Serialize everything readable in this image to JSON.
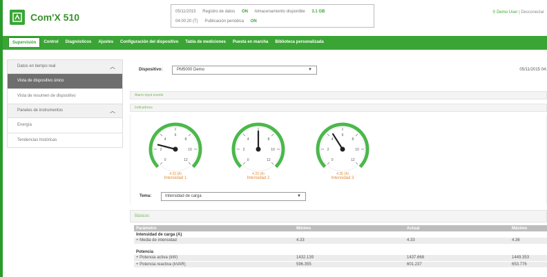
{
  "header": {
    "app_title": "Com'X 510",
    "status": {
      "date1": "05/11/2015",
      "date2": "04:00:20 (T)",
      "log_label": "Registro de datos",
      "log_status": "ON",
      "publish_label": "Publicación periódica",
      "publish_status": "ON",
      "storage_label": "Almacenamiento disponible",
      "storage_value": "3.1 GB"
    },
    "user": "Demo User",
    "logout": "Desconectar"
  },
  "menu": {
    "tabs": [
      "Supervisión",
      "Control",
      "Diagnósticos",
      "Ajustes",
      "Configuración del dispositivo",
      "Tabla de mediciones",
      "Puesta en marcha",
      "Biblioteca personalizada"
    ]
  },
  "sidebar": {
    "group1": "Datos en tiempo real",
    "item1": "Vista de dispositivo único",
    "item2": "Vista de resumen de dispositivo",
    "group2": "Paneles de instrumentos",
    "item3": "Energía",
    "item4": "Tendencias históricas"
  },
  "main": {
    "device_label": "Dispositivo:",
    "device_value": "PM5000 Demo",
    "datetime": "05/11/2015 04:",
    "section1": "Alarm input events",
    "section2": "Indicadores",
    "gauges": [
      {
        "value_text": "4.33 (A)",
        "label": "Intensidad 1",
        "needle": 0.22
      },
      {
        "value_text": "4.33 (A)",
        "label": "Intensidad 2",
        "needle": 0.5
      },
      {
        "value_text": "4.36 (A)",
        "label": "Intensidad 3",
        "needle": 0.38
      }
    ],
    "gauge_ticks": [
      "0",
      "2",
      "4",
      "6",
      "8",
      "10",
      "12"
    ],
    "tema_label": "Tema:",
    "tema_value": "Intensidad de carga",
    "basic_label": "Básicos",
    "table": {
      "headers": [
        "Parámetro",
        "Mínimo",
        "Actual",
        "Máximo"
      ],
      "group1": "Intensidad de carga (A)",
      "row1": [
        "+ Media de intensidad",
        "4.33",
        "4.33",
        "4.36"
      ],
      "group2": "Potencia",
      "row2": [
        "+ Potencia activa (kW)",
        "1432.139",
        "1437.668",
        "1449.353"
      ],
      "row3": [
        "+ Potencia reactiva (kVAR)",
        "596.355",
        "601.237",
        "653.776"
      ]
    }
  },
  "colors": {
    "brand_green": "#3aa535",
    "gauge_orange": "#e08a3a",
    "active_sidebar": "#6e6e6e"
  }
}
